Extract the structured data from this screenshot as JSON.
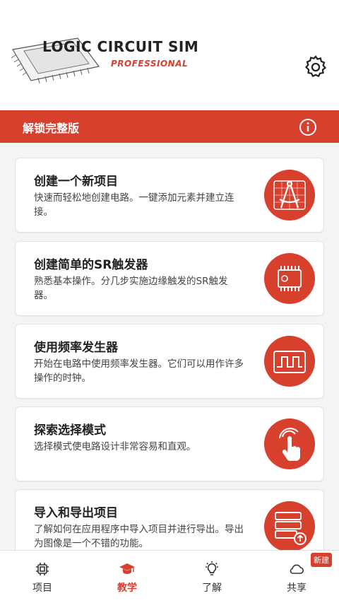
{
  "header": {
    "logo_title": "LOGIC CIRCUIT SIM",
    "logo_subtitle": "PROFESSIONAL"
  },
  "unlock_bar": {
    "label": "解锁完整版"
  },
  "cards": [
    {
      "title": "创建一个新项目",
      "description": "快速而轻松地创建电路。一键添加元素并建立连接。",
      "icon": "compass-drafting-icon"
    },
    {
      "title": "创建简单的SR触发器",
      "description": "熟悉基本操作。分几步实施边缘触发的SR触发器。",
      "icon": "chip-icon"
    },
    {
      "title": "使用频率发生器",
      "description": "开始在电路中使用频率发生器。它们可以用作许多操作的时钟。",
      "icon": "square-wave-icon"
    },
    {
      "title": "探索选择模式",
      "description": "选择模式使电路设计非常容易和直观。",
      "icon": "touch-select-icon"
    },
    {
      "title": "导入和导出项目",
      "description": "了解如何在应用程序中导入项目并进行导出。导出为图像是一个不错的功能。",
      "icon": "server-export-icon"
    }
  ],
  "tabs": [
    {
      "label": "项目",
      "icon": "chip-tab-icon"
    },
    {
      "label": "教学",
      "icon": "graduation-cap-icon",
      "active": true
    },
    {
      "label": "了解",
      "icon": "lightbulb-icon"
    },
    {
      "label": "共享",
      "icon": "cloud-icon"
    }
  ],
  "badge": "新建",
  "colors": {
    "accent": "#d8402e"
  }
}
